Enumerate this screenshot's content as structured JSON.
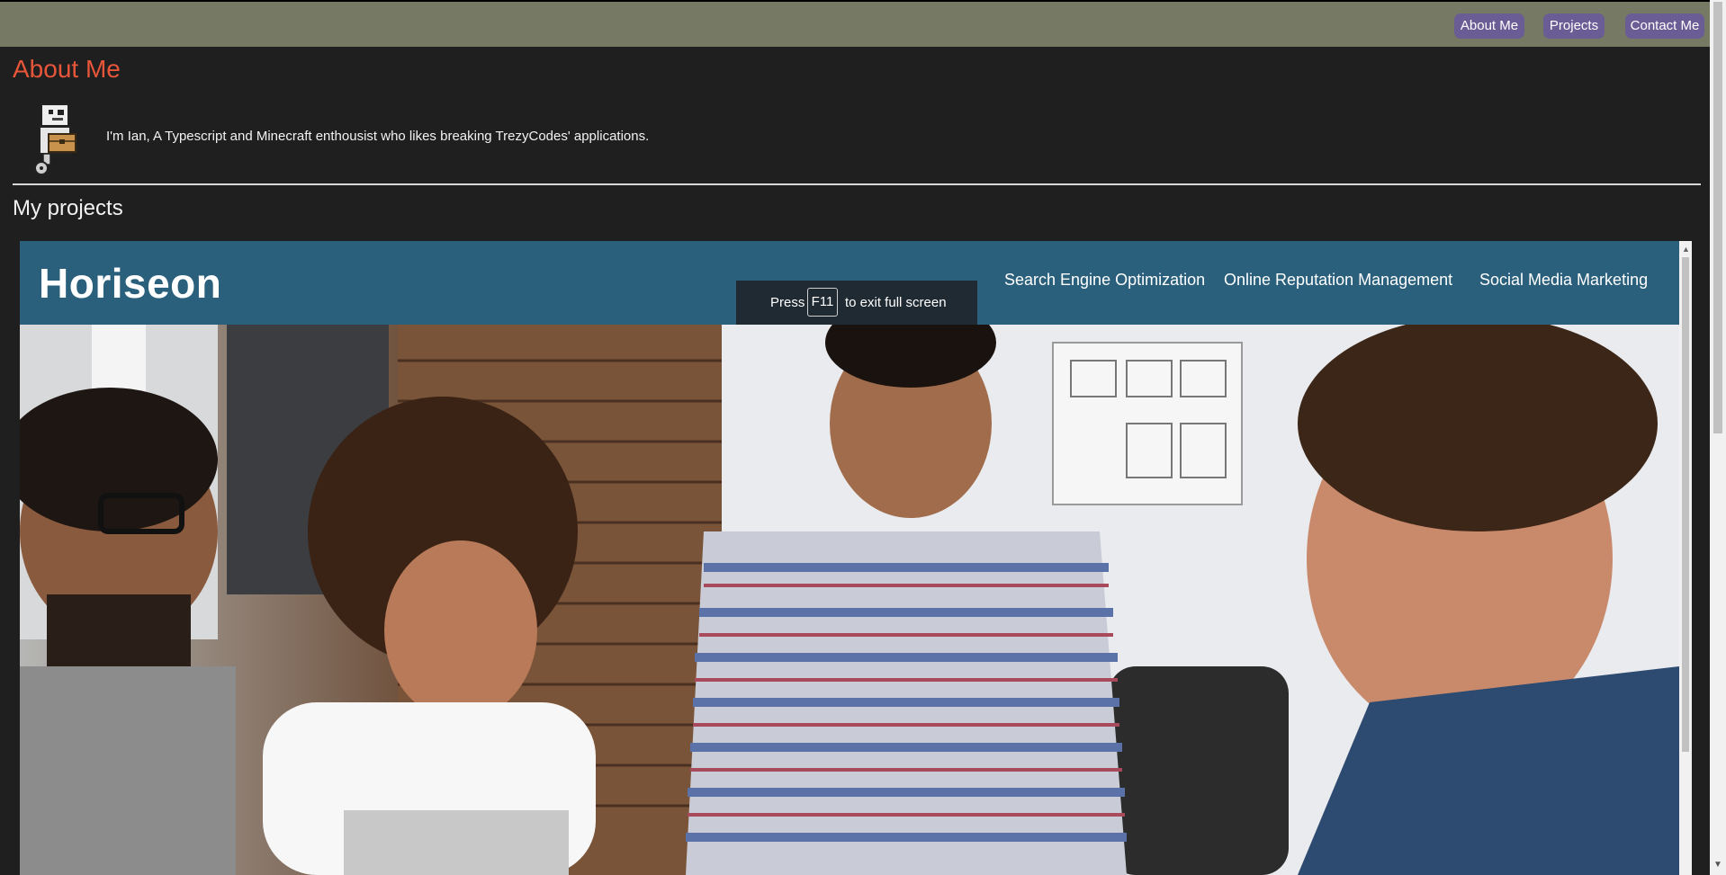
{
  "nav": {
    "about": "About Me",
    "projects": "Projects",
    "contact": "Contact Me"
  },
  "about": {
    "title": "About Me",
    "intro": "I'm Ian, A Typescript and Minecraft enthousist who likes breaking TrezyCodes' applications."
  },
  "projects": {
    "title": "My projects",
    "embed": {
      "logo": "Horiseon",
      "nav": [
        "Search Engine Optimization",
        "Online Reputation Management",
        "Social Media Marketing"
      ],
      "fullscreen_notice": {
        "press": "Press",
        "key": "F11",
        "suffix": "to exit full screen"
      }
    }
  },
  "colors": {
    "navbar_bg": "#767a64",
    "nav_button_bg": "#6a5c94",
    "page_bg": "#1f1f1f",
    "title_accent": "#e8563a",
    "embed_header_bg": "#2a607c"
  },
  "icons": {
    "avatar": "robot-carrying-box-icon"
  }
}
